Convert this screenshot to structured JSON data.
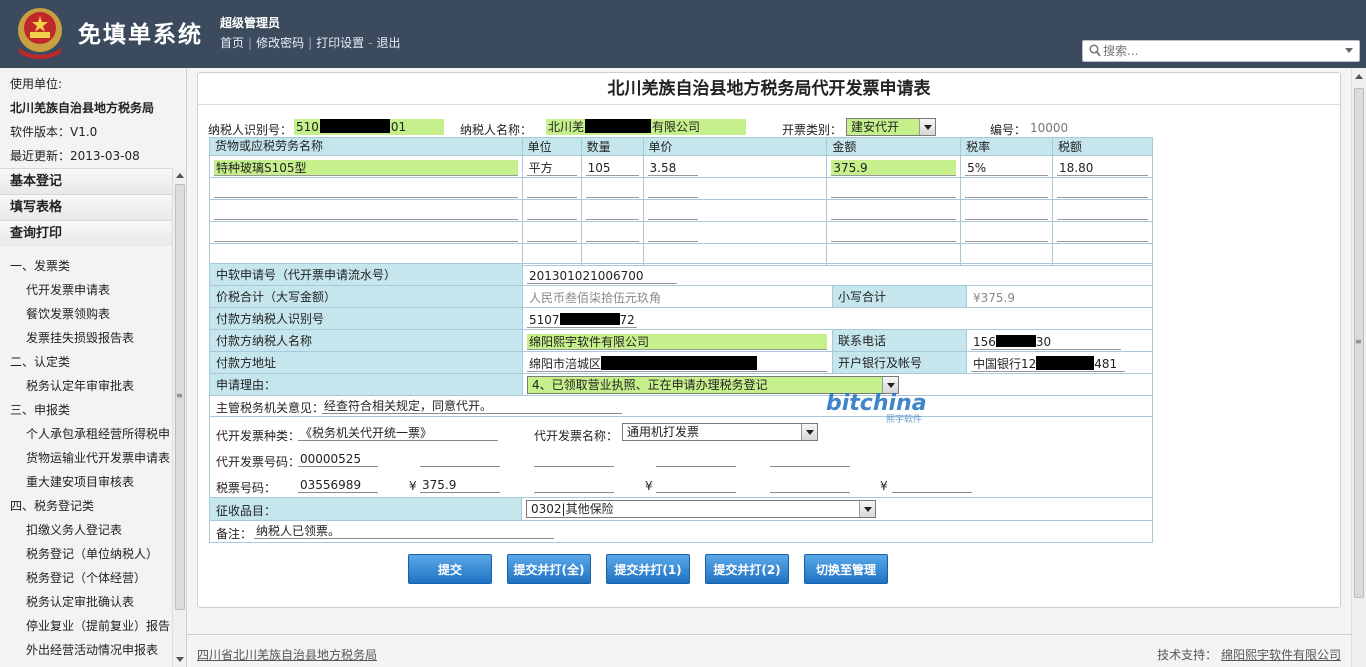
{
  "header": {
    "app_title": "免填单系统",
    "user_role": "超级管理员",
    "nav": [
      "首页",
      "修改密码",
      "打印设置",
      "退出"
    ],
    "search_placeholder": "搜索..."
  },
  "sidebar": {
    "unit_label": "使用单位:",
    "unit_name": "北川羌族自治县地方税务局",
    "version": "软件版本：V1.0",
    "updated": "最近更新：2013-03-08",
    "sections": [
      "基本登记",
      "填写表格",
      "查询打印"
    ],
    "categories": [
      {
        "title": "一、发票类",
        "items": [
          "代开发票申请表",
          "餐饮发票领购表",
          "发票挂失损毁报告表"
        ]
      },
      {
        "title": "二、认定类",
        "items": [
          "税务认定年审审批表"
        ]
      },
      {
        "title": "三、申报类",
        "items": [
          "个人承包承租经营所得税申",
          "货物运输业代开发票申请表",
          "重大建安项目审核表"
        ]
      },
      {
        "title": "四、税务登记类",
        "items": [
          "扣缴义务人登记表",
          "税务登记（单位纳税人）",
          "税务登记（个体经营）",
          "税务认定审批确认表",
          "停业复业（提前复业）报告",
          "外出经营活动情况申报表"
        ]
      }
    ]
  },
  "form": {
    "title": "北川羌族自治县地方税务局代开发票申请表",
    "taxpayer_id_label": "纳税人识别号：",
    "taxpayer_id_start": "510",
    "taxpayer_id_end": "01",
    "taxpayer_name_label": "纳税人名称：",
    "taxpayer_name_start": "北川羌",
    "taxpayer_name_end": "有限公司",
    "invoice_type_label": "开票类别：",
    "invoice_type_value": "建安代开",
    "serial_label": "编号：",
    "serial_value": "10000",
    "goods_headers": [
      "货物或应税劳务名称",
      "单位",
      "数量",
      "单价",
      "金额",
      "税率",
      "税额"
    ],
    "goods_row": [
      "特种玻璃S105型",
      "平方",
      "105",
      "3.58",
      "375.9",
      "5%",
      "18.80"
    ],
    "row_labels": {
      "software_no": "中软申请号（代开票申请流水号）",
      "total_upper": "价税合计（大写金额）",
      "total_lower": "小写合计",
      "payer_id": "付款方纳税人识别号",
      "payer_name": "付款方纳税人名称",
      "phone": "联系电话",
      "payer_addr": "付款方地址",
      "bank": "开户银行及帐号",
      "reason": "申请理由："
    },
    "software_no": "201301021006700",
    "total_upper": "人民币叁佰柒拾伍元玖角",
    "total_lower": "¥375.9",
    "payer_id_start": "5107",
    "payer_id_end": "72",
    "payer_name": "绵阳熙宇软件有限公司",
    "phone_start": "156",
    "phone_end": "30",
    "payer_addr": "绵阳市涪城区",
    "bank_start": "中国银行12",
    "bank_end": "481",
    "reason": "4、已领取营业执照、正在申请办理税务登记",
    "opinion_label": "主管税务机关意见：",
    "opinion": "经查符合相关规定，同意代开。",
    "proxy_kind_label": "代开发票种类：",
    "proxy_kind": "《税务机关代开统一票》",
    "proxy_name_label": "代开发票名称：",
    "proxy_name": "通用机打发票",
    "proxy_no_label": "代开发票号码：",
    "proxy_no": "00000525",
    "ticket_no_label": "税票号码：",
    "ticket_no": "03556989",
    "yen": "¥",
    "ticket_amount": "375.9",
    "levy_label": "征收品目：",
    "levy": "0302|其他保险",
    "remark_label": "备注：",
    "remark": "纳税人已领票。"
  },
  "buttons": [
    "提交",
    "提交并打(全)",
    "提交并打(1)",
    "提交并打(2)",
    "切换至管理"
  ],
  "watermark": {
    "text": "bitchina",
    "sub": "熙宇软件"
  },
  "footer": {
    "left": "四川省北川羌族自治县地方税务局",
    "support_label": "技术支持：",
    "support": "绵阳熙宇软件有限公司"
  }
}
